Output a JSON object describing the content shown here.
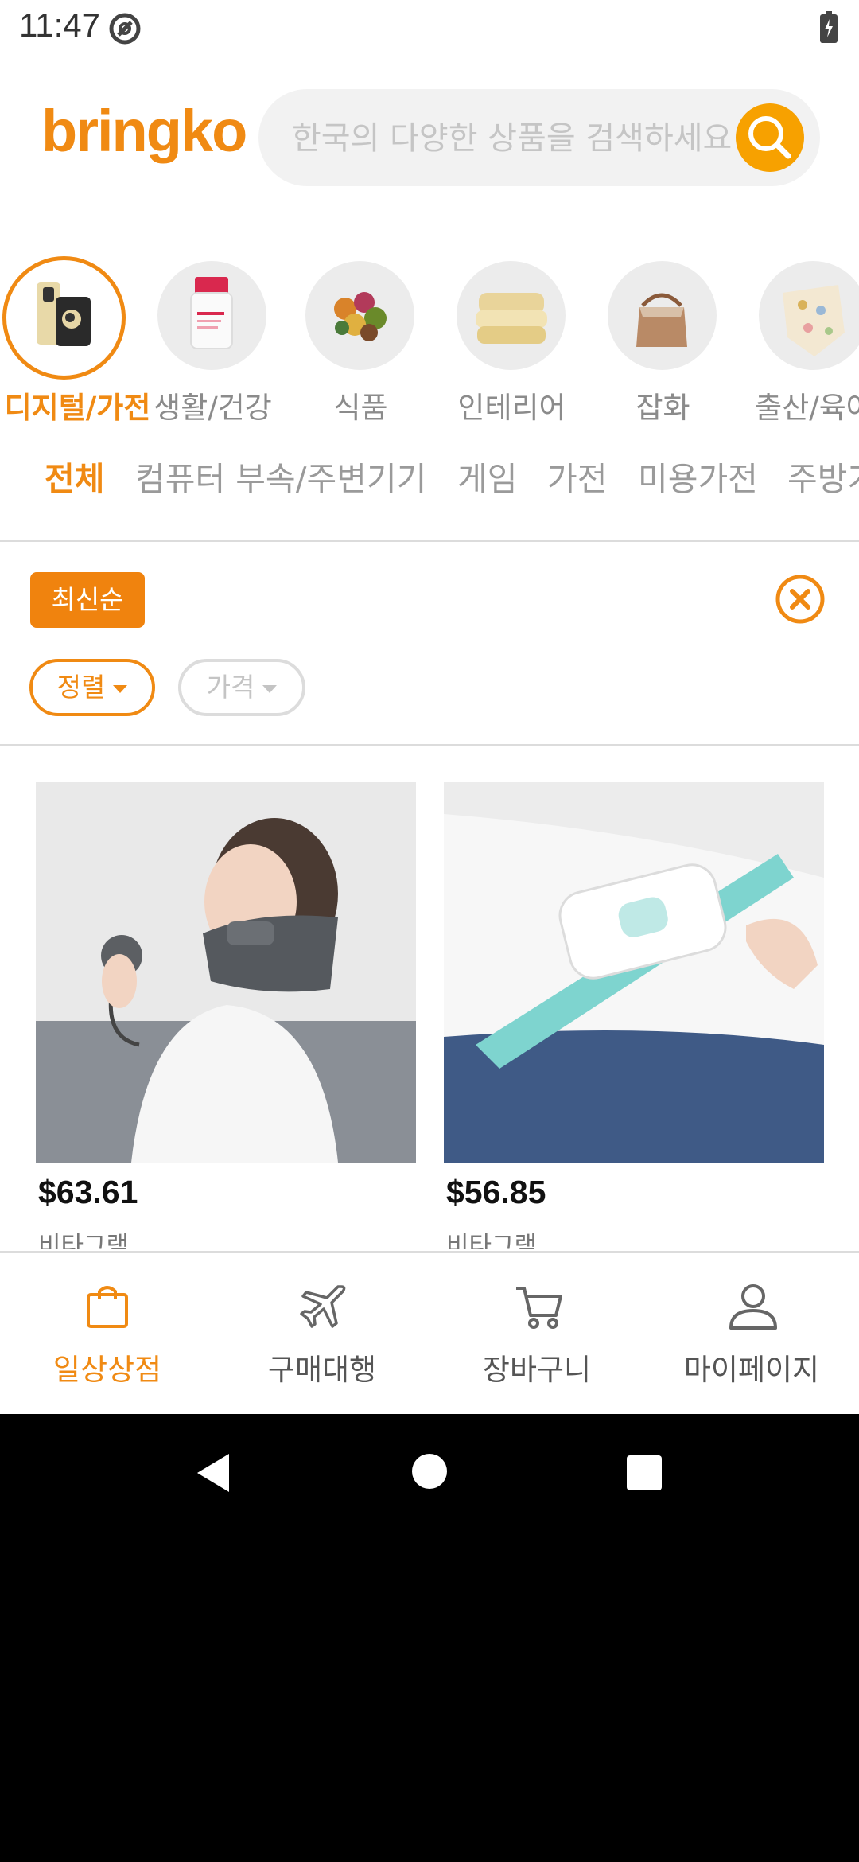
{
  "status_bar": {
    "time": "11:47"
  },
  "header": {
    "logo": "bringko",
    "search": {
      "placeholder": "한국의 다양한 상품을 검색하세요",
      "value": ""
    }
  },
  "categories": [
    {
      "label": "디지털/가전",
      "icon": "smartphone-icon",
      "active": true
    },
    {
      "label": "생활/건강",
      "icon": "supplement-bottle-icon",
      "active": false
    },
    {
      "label": "식품",
      "icon": "food-bowl-icon",
      "active": false
    },
    {
      "label": "인테리어",
      "icon": "pillow-icon",
      "active": false
    },
    {
      "label": "잡화",
      "icon": "handbag-icon",
      "active": false
    },
    {
      "label": "출산/육아",
      "icon": "baby-goods-icon",
      "active": false
    }
  ],
  "subcategories": [
    {
      "label": "전체",
      "active": true
    },
    {
      "label": "컴퓨터 부속/주변기기",
      "active": false
    },
    {
      "label": "게임",
      "active": false
    },
    {
      "label": "가전",
      "active": false
    },
    {
      "label": "미용가전",
      "active": false
    },
    {
      "label": "주방가전",
      "active": false
    }
  ],
  "filters": {
    "active_sort": "최신순",
    "pills": [
      {
        "label": "정렬",
        "active": true
      },
      {
        "label": "가격",
        "active": false
      }
    ]
  },
  "products": [
    {
      "price": "$63.61",
      "brand": "비타그램",
      "image": "neck-traction-device-photo"
    },
    {
      "price": "$56.85",
      "brand": "비타그램",
      "image": "waist-massager-photo"
    }
  ],
  "bottom_nav": [
    {
      "label": "일상상점",
      "icon": "shopping-bag-icon",
      "active": true
    },
    {
      "label": "구매대행",
      "icon": "airplane-icon",
      "active": false
    },
    {
      "label": "장바구니",
      "icon": "cart-icon",
      "active": false
    },
    {
      "label": "마이페이지",
      "icon": "user-icon",
      "active": false
    }
  ],
  "colors": {
    "accent": "#f08a13",
    "search_button": "#f7a100",
    "inactive_text": "#8b8b8b"
  }
}
